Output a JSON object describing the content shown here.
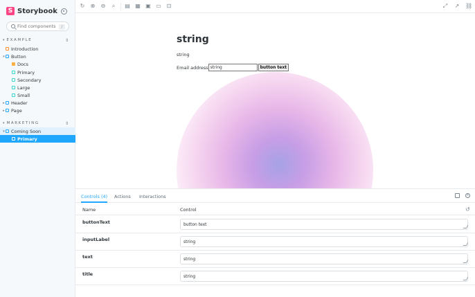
{
  "brand": {
    "name": "Storybook"
  },
  "search": {
    "placeholder": "Find components",
    "shortcut": "/"
  },
  "sidebar": {
    "groups": [
      {
        "title": "EXAMPLE",
        "items": [
          {
            "label": "Introduction"
          },
          {
            "label": "Button"
          },
          {
            "label": "Docs"
          },
          {
            "label": "Primary"
          },
          {
            "label": "Secondary"
          },
          {
            "label": "Large"
          },
          {
            "label": "Small"
          },
          {
            "label": "Header"
          },
          {
            "label": "Page"
          }
        ]
      },
      {
        "title": "MARKETING",
        "items": [
          {
            "label": "Coming Soon"
          },
          {
            "label": "Primary"
          }
        ]
      }
    ]
  },
  "story": {
    "title": "string",
    "text": "string",
    "input_label": "Email address",
    "input_value": "string",
    "button_text": "button text"
  },
  "panel": {
    "tabs": [
      {
        "label": "Controls (4)"
      },
      {
        "label": "Actions"
      },
      {
        "label": "Interactions"
      }
    ],
    "columns": {
      "name": "Name",
      "control": "Control"
    },
    "rows": [
      {
        "name": "buttonText",
        "value": "button text"
      },
      {
        "name": "inputLabel",
        "value": "string"
      },
      {
        "name": "text",
        "value": "string"
      },
      {
        "name": "title",
        "value": "string"
      }
    ]
  },
  "colors": {
    "accent": "#1ea7fd",
    "brand": "#ff4785"
  }
}
